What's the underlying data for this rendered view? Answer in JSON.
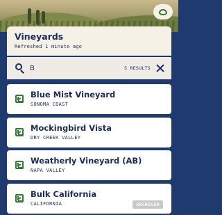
{
  "header": {
    "title": "Vineyards",
    "subtitle": "Refreshed 1 minute ago",
    "action_icon": "leaf-icon"
  },
  "search": {
    "value": "B",
    "result_count": "5 RESULTS",
    "search_icon": "search-icon",
    "clear_icon": "close-icon"
  },
  "vineyards": [
    {
      "name": "Blue Mist Vineyard",
      "region": "SONOMA COAST",
      "icon": "vineyard-icon"
    },
    {
      "name": "Mockingbird Vista",
      "region": "DRY CREEK VALLEY",
      "icon": "vineyard-icon"
    },
    {
      "name": "Weatherly Vineyard (AB)",
      "region": "NAPA VALLEY",
      "icon": "vineyard-icon"
    },
    {
      "name": "Bulk California",
      "region": "CALIFORNIA",
      "icon": "vineyard-icon",
      "badge": "ARCHIVED"
    }
  ],
  "colors": {
    "primary": "#1a2b5c",
    "accent": "#2e7d32",
    "background": "#1f3a6e",
    "card": "#ffffff",
    "header_bg": "#f6f1e7",
    "badge_bg": "#c8c8c8"
  }
}
